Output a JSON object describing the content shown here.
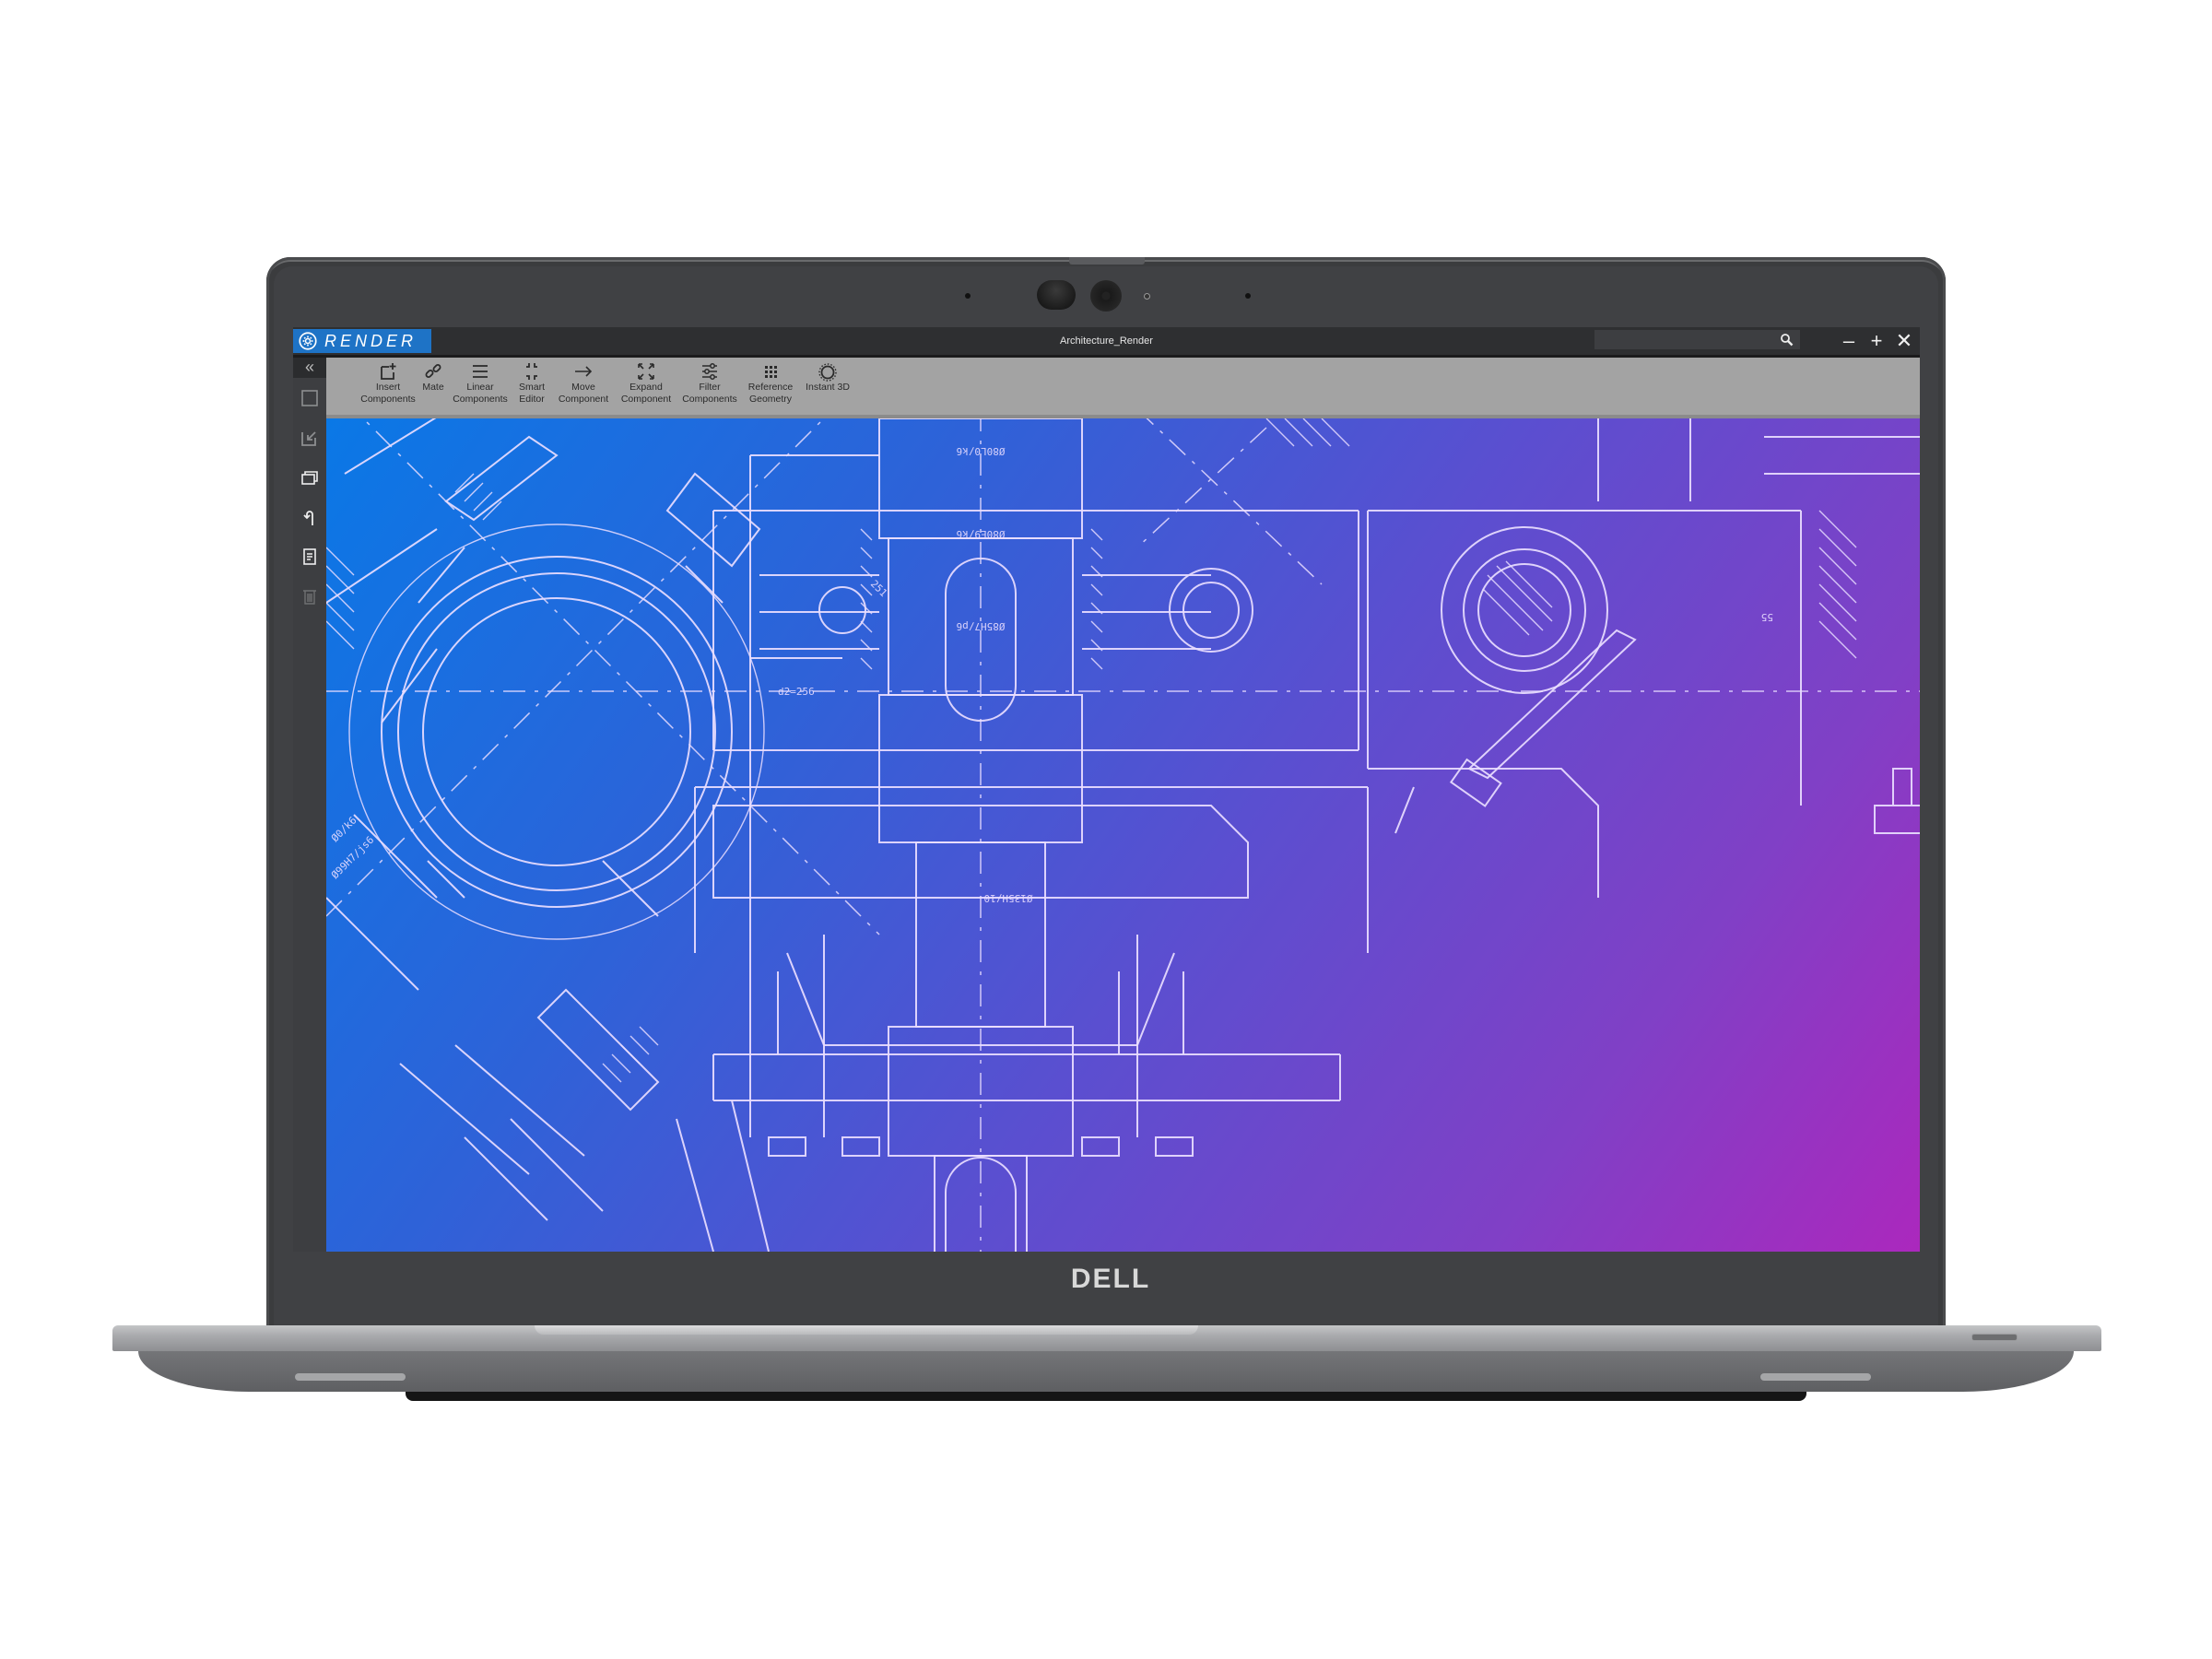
{
  "device": {
    "brand_logo": "DELL",
    "colors": {
      "lid": "#3b3c3e",
      "bezel": "#404144",
      "chassis": "#a9aaad"
    }
  },
  "app": {
    "brand_name": "RENDER",
    "brand_icon": "gear-icon",
    "brand_color": "#1e73c6",
    "document_title": "Architecture_Render",
    "search": {
      "value": "",
      "placeholder": "",
      "icon": "search-icon"
    },
    "window_controls": [
      {
        "name": "minimize",
        "glyph": "–"
      },
      {
        "name": "maximize",
        "glyph": "+"
      },
      {
        "name": "close",
        "glyph": "✕"
      }
    ]
  },
  "rail": {
    "collapse_glyph": "«",
    "items": [
      {
        "name": "select",
        "icon": "square-icon"
      },
      {
        "name": "import",
        "icon": "import-arrow-icon"
      },
      {
        "name": "windows",
        "icon": "layers-icon"
      },
      {
        "name": "undo",
        "icon": "undo-icon"
      },
      {
        "name": "document",
        "icon": "document-icon"
      },
      {
        "name": "delete",
        "icon": "trash-icon"
      }
    ]
  },
  "ribbon": {
    "items": [
      {
        "label": "Insert\nComponents",
        "icon": "insert-component-icon"
      },
      {
        "label": "Mate",
        "icon": "link-icon"
      },
      {
        "label": "Linear\nComponents",
        "icon": "linear-pattern-icon"
      },
      {
        "label": "Smart\nEditor",
        "icon": "smart-editor-icon"
      },
      {
        "label": "Move\nComponent",
        "icon": "arrow-right-icon"
      },
      {
        "label": "Expand\nComponent",
        "icon": "expand-icon"
      },
      {
        "label": "Filter\nComponents",
        "icon": "filter-sliders-icon"
      },
      {
        "label": "Reference\nGeometry",
        "icon": "grid-dots-icon"
      },
      {
        "label": "Instant 3D",
        "icon": "instant-3d-icon"
      }
    ]
  },
  "viewport": {
    "gradient": [
      "#0a78e6",
      "#2e62d8",
      "#5a4fd0",
      "#8040c6",
      "#ab28bd"
    ],
    "annotations": [
      "Ø80L0/k6",
      "Ø80E9/k6",
      "Ø85H7/p6",
      "Ø135H/10",
      "d2=256",
      "251",
      "55",
      "Ø99H7/js6",
      "Ø0/k6"
    ]
  }
}
